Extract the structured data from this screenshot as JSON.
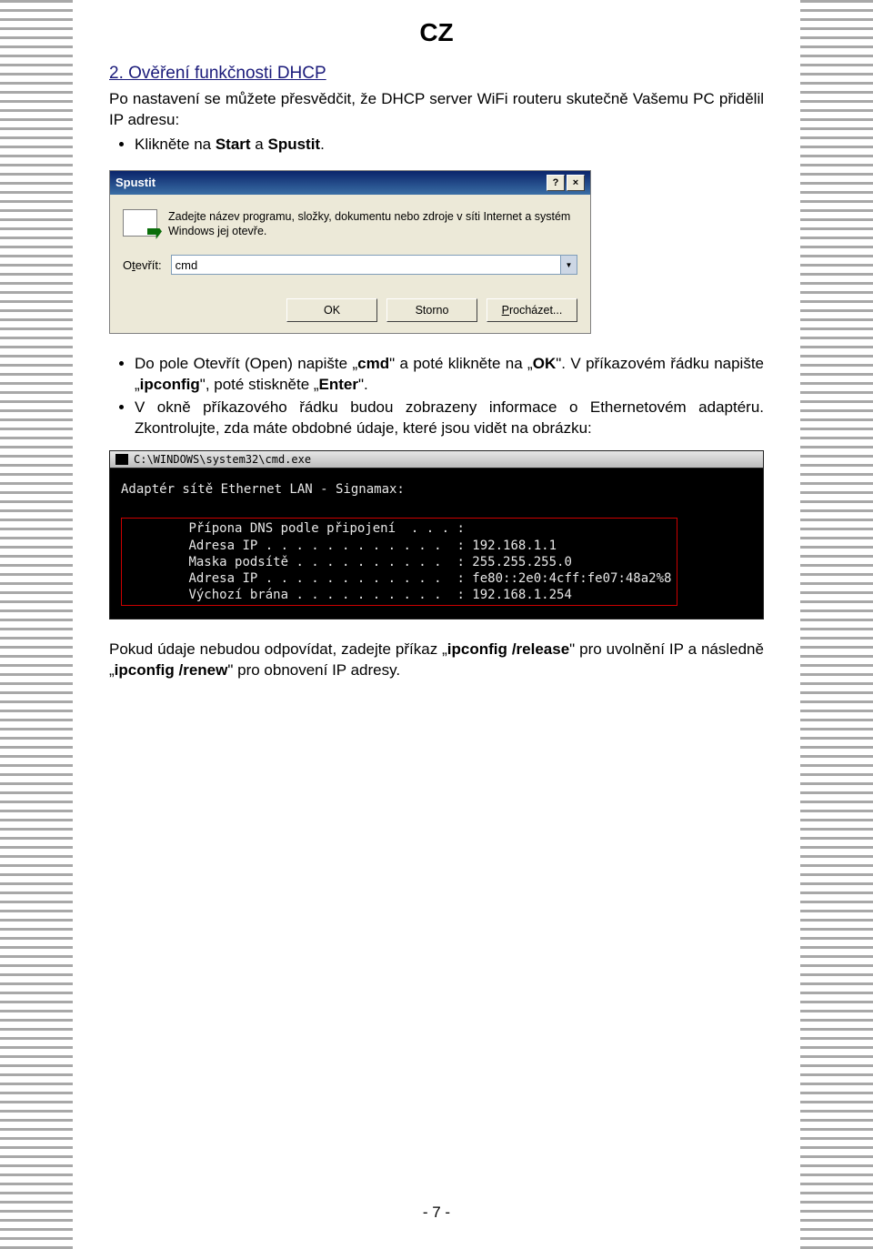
{
  "header": {
    "lang": "CZ"
  },
  "section": {
    "title": "2. Ověření funkčnosti DHCP",
    "intro": "Po nastavení se můžete přesvědčit, že DHCP server WiFi routeru skutečně Vašemu PC přidělil IP adresu:",
    "bullet1_pre": "Klikněte na ",
    "bullet1_b1": "Start",
    "bullet1_mid": " a ",
    "bullet1_b2": "Spustit",
    "bullet1_post": "."
  },
  "run_dialog": {
    "title": "Spustit",
    "help_btn": "?",
    "close_btn": "×",
    "desc": "Zadejte název programu, složky, dokumentu nebo zdroje v síti Internet a systém Windows jej otevře.",
    "label_pre": "O",
    "label_ul": "t",
    "label_post": "evřít:",
    "value": "cmd",
    "ok": "OK",
    "cancel": "Storno",
    "browse_ul": "P",
    "browse_post": "rocházet..."
  },
  "mid": {
    "b2_pre": "Do pole Otevřít (Open) napište „",
    "b2_cmd": "cmd",
    "b2_mid": "\" a poté klikněte na „",
    "b2_ok": "OK",
    "b2_post": "\". V příkazovém řádku napište „",
    "b2_ipc": "ipconfig",
    "b2_mid2": "\", poté stiskněte „",
    "b2_enter": "Enter",
    "b2_end": "\".",
    "b3": "V okně příkazového řádku budou zobrazeny informace o Ethernetovém adaptéru. Zkontrolujte, zda máte obdobné údaje, které jsou vidět na obrázku:"
  },
  "cmd": {
    "title": "C:\\WINDOWS\\system32\\cmd.exe",
    "line_adapter": "Adaptér sítě Ethernet LAN - Signamax:",
    "l1": "Přípona DNS podle připojení  . . . :",
    "l2": "Adresa IP . . . . . . . . . . . .  : 192.168.1.1",
    "l3": "Maska podsítě . . . . . . . . . .  : 255.255.255.0",
    "l4": "Adresa IP . . . . . . . . . . . .  : fe80::2e0:4cff:fe07:48a2%8",
    "l5": "Výchozí brána . . . . . . . . . .  : 192.168.1.254"
  },
  "outro": {
    "pre": "Pokud údaje nebudou odpovídat, zadejte příkaz „",
    "b1": "ipconfig /release",
    "mid": "\" pro uvolnění IP a následně „",
    "b2": "ipconfig /renew",
    "post": "\" pro obnovení IP adresy."
  },
  "footer": {
    "page": "- 7 -"
  }
}
